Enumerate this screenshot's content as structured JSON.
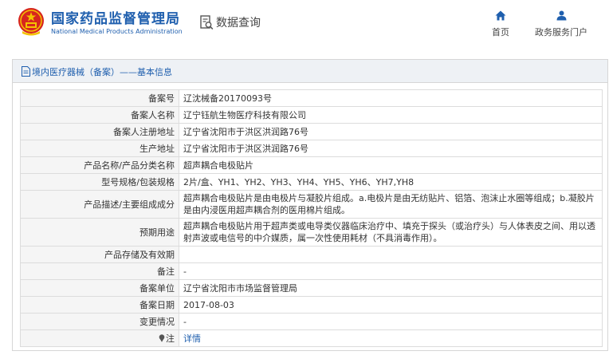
{
  "header": {
    "site_title_cn": "国家药品监督管理局",
    "site_title_en": "National Medical Products Administration",
    "query_title": "数据查询",
    "nav": {
      "home_label": "首页",
      "service_label": "政务服务门户"
    }
  },
  "section": {
    "breadcrumb": "境内医疗器械（备案）——基本信息"
  },
  "rows": [
    {
      "label": "备案号",
      "value": "辽沈械备20170093号"
    },
    {
      "label": "备案人名称",
      "value": "辽宁钰航生物医疗科技有限公司"
    },
    {
      "label": "备案人注册地址",
      "value": "辽宁省沈阳市于洪区洪润路76号"
    },
    {
      "label": "生产地址",
      "value": "辽宁省沈阳市于洪区洪润路76号"
    },
    {
      "label": "产品名称/产品分类名称",
      "value": "超声耦合电极贴片"
    },
    {
      "label": "型号规格/包装规格",
      "value": "2片/盒、YH1、YH2、YH3、YH4、YH5、YH6、YH7,YH8"
    },
    {
      "label": "产品描述/主要组成成分",
      "value": "超声耦合电极贴片是由电极片与凝胶片组成。a.电极片是由无纺贴片、铝箔、泡沫止水圈等组成；b.凝胶片是由内浸医用超声耦合剂的医用棉片组成。"
    },
    {
      "label": "预期用途",
      "value": "超声耦合电极贴片用于超声类或电导类仪器临床治疗中、填充于探头（或治疗头）与人体表皮之间、用以透射声波或电信号的中介媒质，属一次性使用耗材（不具消毒作用）。"
    },
    {
      "label": "产品存储及有效期",
      "value": ""
    },
    {
      "label": "备注",
      "value": "-"
    },
    {
      "label": "备案单位",
      "value": "辽宁省沈阳市市场监督管理局"
    },
    {
      "label": "备案日期",
      "value": "2017-08-03"
    },
    {
      "label": "变更情况",
      "value": "-"
    },
    {
      "label": "注",
      "value": "详情"
    }
  ],
  "colors": {
    "brand_blue": "#1f5fae",
    "emblem_red": "#d7261e",
    "emblem_gold": "#f4c300"
  },
  "icons": {
    "emblem": "national-emblem-icon",
    "query": "search-document-icon",
    "home": "home-icon",
    "service": "user-icon",
    "breadcrumb": "document-icon",
    "note": "pin-icon"
  }
}
